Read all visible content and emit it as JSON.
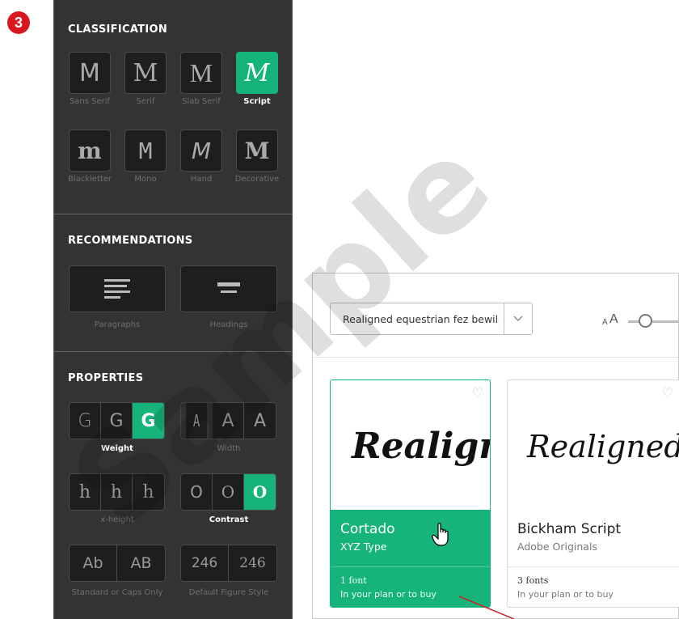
{
  "step_number": "3",
  "accent_color": "#16b47a",
  "classification": {
    "title": "CLASSIFICATION",
    "items": [
      {
        "glyph": "M",
        "label": "Sans Serif",
        "active": false
      },
      {
        "glyph": "M",
        "label": "Serif",
        "active": false
      },
      {
        "glyph": "M",
        "label": "Slab Serif",
        "active": false
      },
      {
        "glyph": "M",
        "label": "Script",
        "active": true
      },
      {
        "glyph": "m",
        "label": "Blackletter",
        "active": false
      },
      {
        "glyph": "M",
        "label": "Mono",
        "active": false
      },
      {
        "glyph": "M",
        "label": "Hand",
        "active": false
      },
      {
        "glyph": "M",
        "label": "Decorative",
        "active": false
      }
    ]
  },
  "recommendations": {
    "title": "RECOMMENDATIONS",
    "items": [
      {
        "label": "Paragraphs",
        "icon": "paragraph-lines-icon"
      },
      {
        "label": "Headings",
        "icon": "heading-lines-icon"
      }
    ]
  },
  "properties": {
    "title": "PROPERTIES",
    "weight": {
      "cells": [
        "G",
        "G",
        "G"
      ],
      "active_index": 2,
      "label": "Weight",
      "active": true
    },
    "width": {
      "cells": [
        "A",
        "A",
        "A"
      ],
      "label": "Width",
      "active": false
    },
    "xheight": {
      "cells": [
        "h",
        "h",
        "h"
      ],
      "label": "x-height",
      "active": false
    },
    "contrast": {
      "cells": [
        "O",
        "O",
        "O"
      ],
      "active_index": 2,
      "label": "Contrast",
      "active": true
    },
    "caps": {
      "cells": [
        "Ab",
        "AB"
      ],
      "label": "Standard or Caps Only",
      "active": false
    },
    "figure": {
      "cells": [
        "246",
        "246"
      ],
      "label": "Default Figure Style",
      "active": false
    }
  },
  "search": {
    "value": "Realigned equestrian fez bewilde"
  },
  "size_toggle": {
    "small": "A",
    "big": "A"
  },
  "cards": [
    {
      "sample": "Realigne",
      "name": "Cortado",
      "foundry": "XYZ Type",
      "count": "1 font",
      "plan": "In your plan or to buy",
      "selected": true
    },
    {
      "sample": "Realigned",
      "name": "Bickham Script",
      "foundry": "Adobe Originals",
      "count": "3 fonts",
      "plan": "In your plan or to buy",
      "selected": false
    }
  ]
}
